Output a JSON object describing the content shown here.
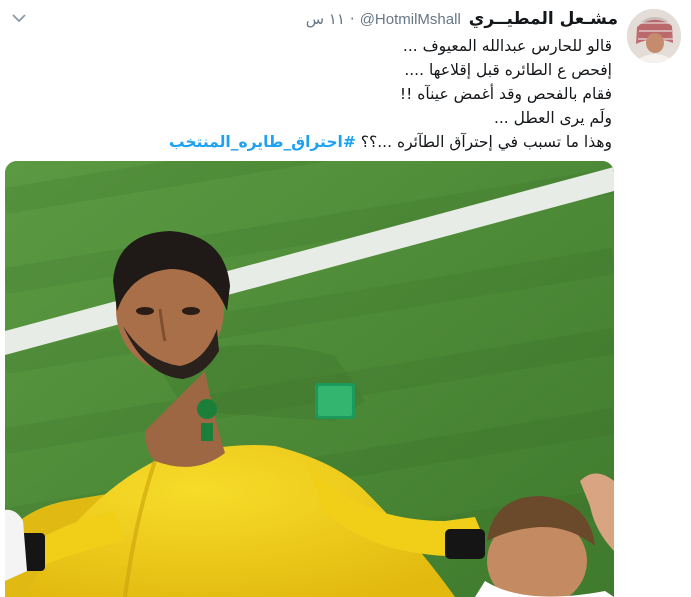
{
  "tweet": {
    "display_name": "مشـعل المطيــري",
    "handle": "@HotmilMshall",
    "separator": "·",
    "timestamp": "١١ س",
    "lines": [
      "قالو للحارس عبدالله المعيوف ...",
      "إفحص ع الطائره قبل إقلاعها ....",
      "فقام بالفحص وقد أغمض عينآه !!",
      "ولَم يرى العطل ...",
      "وهذا ما تسبب في إحترآق الطآئره ...؟؟"
    ],
    "hashtag": "#احتراق_طايره_المنتخب",
    "icons": {
      "more": "chevron-down-icon"
    }
  },
  "media": {
    "colors": {
      "jersey": "#f2d21a",
      "pitch": "#4d8a37",
      "line": "#e8ece6"
    }
  }
}
